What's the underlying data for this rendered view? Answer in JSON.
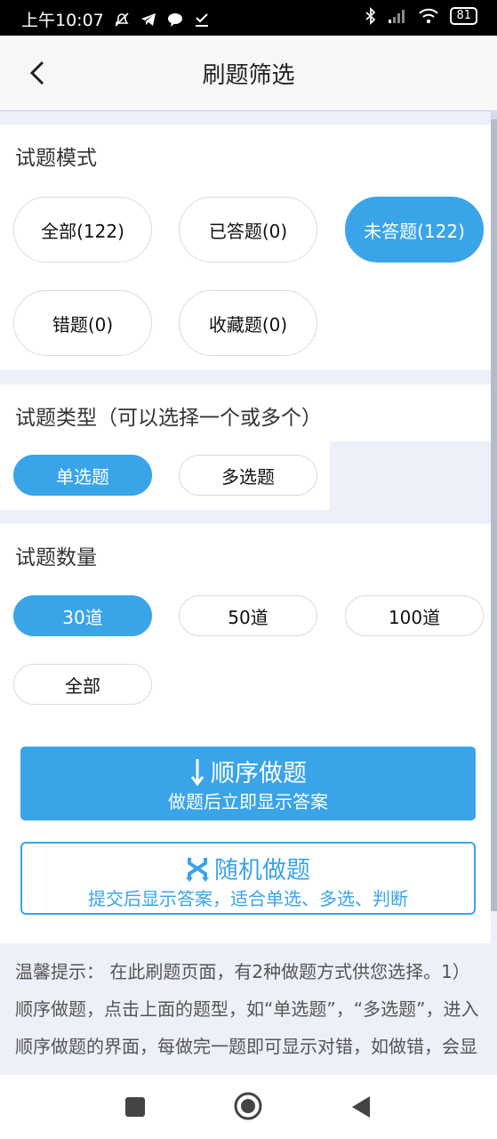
{
  "status_bar": {
    "time": "上午10:07",
    "battery": "81"
  },
  "header": {
    "title": "刷题筛选"
  },
  "mode": {
    "title": "试题模式",
    "options": [
      "全部(122)",
      "已答题(0)",
      "未答题(122)",
      "错题(0)",
      "收藏题(0)"
    ],
    "selected": "未答题(122)"
  },
  "type": {
    "title": "试题类型（可以选择一个或多个）",
    "options": [
      "单选题",
      "多选题"
    ],
    "selected": "单选题"
  },
  "count": {
    "title": "试题数量",
    "options": [
      "30道",
      "50道",
      "100道",
      "全部"
    ],
    "selected": "30道"
  },
  "actions": {
    "sequential": {
      "icon": "arrow-down-icon",
      "label": "顺序做题",
      "sub": "做题后立即显示答案"
    },
    "random": {
      "icon": "shuffle-icon",
      "label": "随机做题",
      "sub": "提交后显示答案，适合单选、多选、判断"
    }
  },
  "tips": {
    "text": "温馨提示： 在此刷题页面，有2种做题方式供您选择。1）顺序做题，点击上面的题型，如“单选题”，“多选题”，进入顺序做题的界面，每做完一题即可显示对错，如做错，会显示正确答案。其中主观题可点击“背"
  },
  "colors": {
    "accent": "#3aa4e9",
    "background": "#eef0f9"
  }
}
